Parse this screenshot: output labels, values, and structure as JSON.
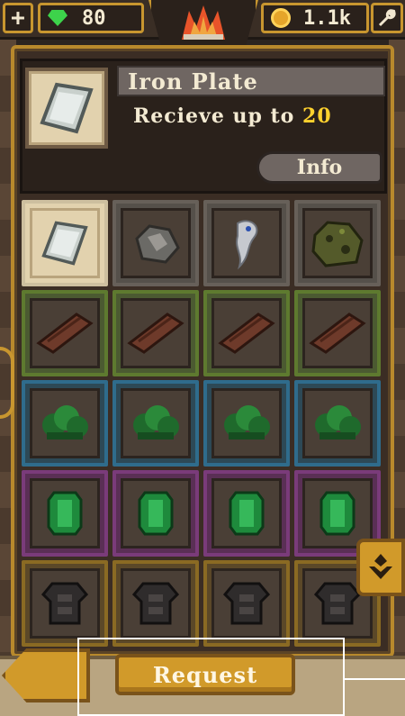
{
  "topbar": {
    "plus_icon": "+",
    "gem_icon": "green-gem-icon",
    "gems": "80",
    "coins": "1.1k",
    "coin_icon": "gold-coin-icon",
    "wrench_icon": "wrench-icon",
    "emblem_icon": "forge-flame-icon"
  },
  "selected_item": {
    "name": "Iron Plate",
    "receive_prefix": "Recieve up to ",
    "receive_amount": "20",
    "info_label": "Info"
  },
  "grid": {
    "rows": [
      {
        "tier": "gray",
        "items": [
          "iron-plate",
          "iron-ore",
          "silver-tooth",
          "moss-rock"
        ]
      },
      {
        "tier": "green",
        "items": [
          "wood-log",
          "wood-log",
          "wood-log",
          "wood-log"
        ]
      },
      {
        "tier": "blue",
        "items": [
          "herb-bush",
          "herb-bush",
          "herb-bush",
          "herb-bush"
        ]
      },
      {
        "tier": "purple",
        "items": [
          "emerald-gem",
          "emerald-gem",
          "emerald-gem",
          "emerald-gem"
        ]
      },
      {
        "tier": "gold",
        "items": [
          "dark-armor",
          "dark-armor",
          "dark-armor",
          "dark-armor"
        ]
      }
    ]
  },
  "footer": {
    "request_label": "Request"
  },
  "colors": {
    "accent_gold": "#c8962f",
    "amount_yellow": "#ffd22e",
    "button_orange": "#d19a2a"
  }
}
